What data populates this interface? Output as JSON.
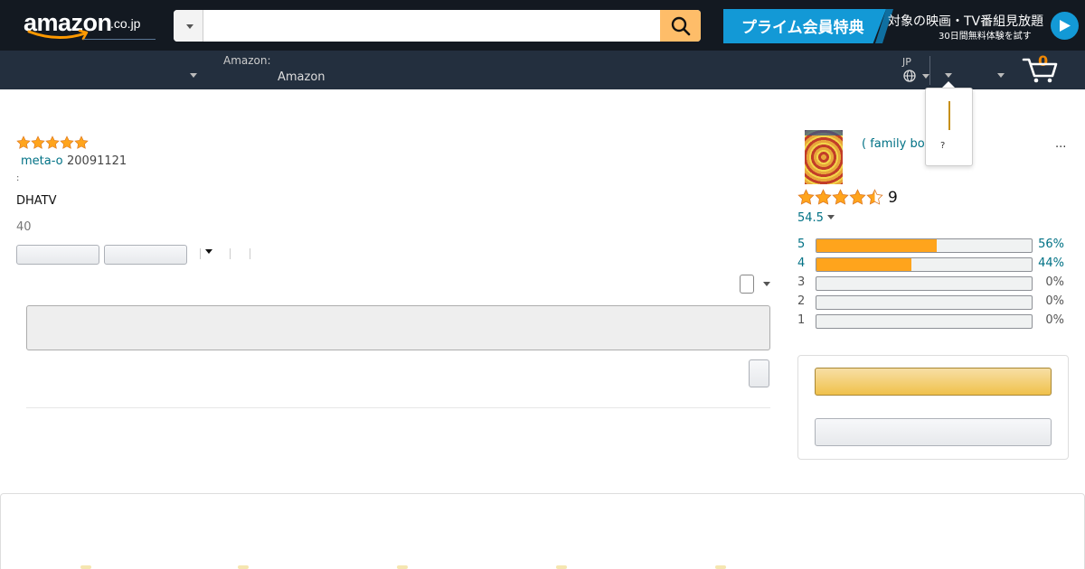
{
  "header": {
    "logo_text": "amazon",
    "logo_tld": ".co.jp",
    "search": {
      "value": "",
      "placeholder": ""
    },
    "prime_banner": {
      "badge": "プライム会員特典",
      "headline": "対象の映画・TV番組見放題",
      "subline": "30日間無料体験を試す"
    },
    "deliver_line1": "Amazon:",
    "deliver_line2": "Amazon",
    "language_code": "JP",
    "cart_count": "0"
  },
  "popover": {
    "text": "?"
  },
  "review": {
    "stars": 5,
    "author": "meta-o",
    "date": "20091121",
    "colon": ":",
    "body": "DHATV",
    "helpful_count": "40"
  },
  "product": {
    "title": "( family bo",
    "ellipsis": "...",
    "rating_stars": 4.5,
    "rating_count": "9",
    "average_rating": "54.5",
    "histogram": [
      {
        "star": "5",
        "percent": 56,
        "percent_label": "56%",
        "has_link": true
      },
      {
        "star": "4",
        "percent": 44,
        "percent_label": "44%",
        "has_link": true
      },
      {
        "star": "3",
        "percent": 0,
        "percent_label": "0%",
        "has_link": false
      },
      {
        "star": "2",
        "percent": 0,
        "percent_label": "0%",
        "has_link": false
      },
      {
        "star": "1",
        "percent": 0,
        "percent_label": "0%",
        "has_link": false
      }
    ]
  },
  "colors": {
    "nav_top": "#131921",
    "nav_bottom": "#232f3e",
    "search_button": "#febd69",
    "prime_blue": "#1399d6",
    "link": "#007185",
    "star": "#ffa41c",
    "cart_count": "#f08804"
  },
  "icons": {
    "search": "search-icon",
    "globe": "globe-icon",
    "cart": "cart-icon",
    "play": "play-icon",
    "caret": "caret-down-icon",
    "star": "star-icon"
  }
}
